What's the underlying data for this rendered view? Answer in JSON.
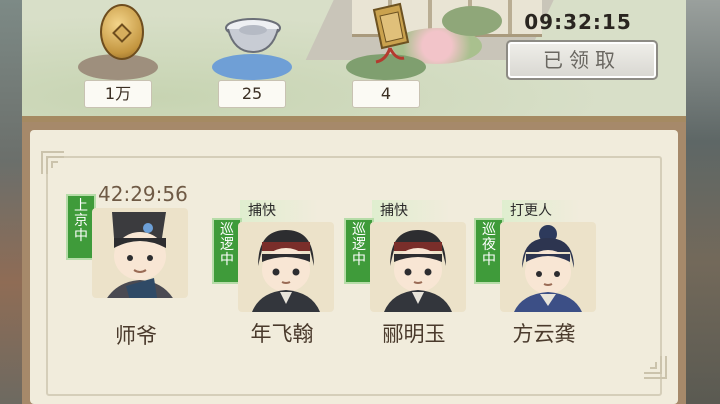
{
  "rewards": [
    {
      "name": "copper-coin",
      "count": "1万"
    },
    {
      "name": "silver-ingot",
      "count": "25"
    },
    {
      "name": "token",
      "count": "4"
    }
  ],
  "timer": "09:32:15",
  "claim_button": "已领取",
  "roster": {
    "countdown": "42:29:56",
    "members": [
      {
        "status": "上京中",
        "job": "",
        "name": "师爷",
        "status_color": "#3f9b3a"
      },
      {
        "status": "巡逻中",
        "job": "捕快",
        "name": "年飞翰",
        "status_color": "#3f9b3a"
      },
      {
        "status": "巡逻中",
        "job": "捕快",
        "name": "郦明玉",
        "status_color": "#3f9b3a"
      },
      {
        "status": "巡夜中",
        "job": "打更人",
        "name": "方云龚",
        "status_color": "#3f9b3a"
      }
    ]
  }
}
